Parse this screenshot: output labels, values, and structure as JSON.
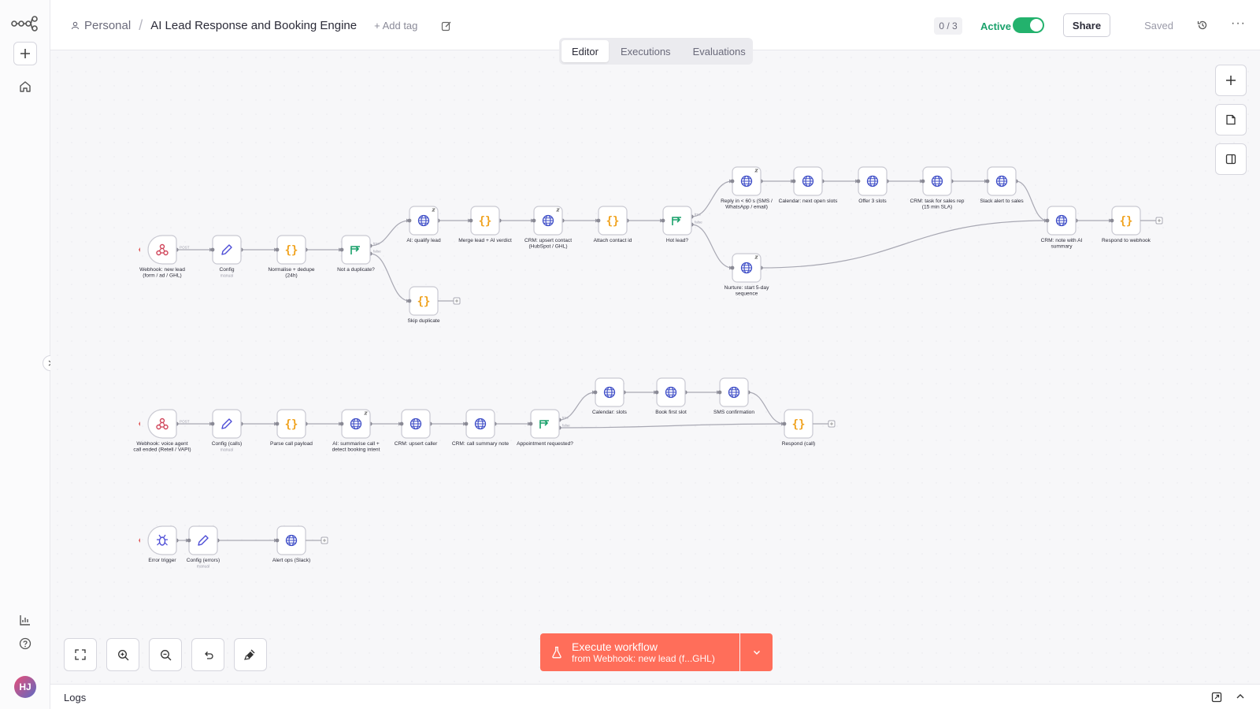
{
  "header": {
    "workspace": "Personal",
    "workflow_title": "AI Lead Response and Booking Engine",
    "add_tag": "+ Add tag",
    "counter": "0 / 3",
    "active_label": "Active",
    "share_label": "Share",
    "saved_label": "Saved"
  },
  "tabs": [
    {
      "label": "Editor",
      "active": true
    },
    {
      "label": "Executions",
      "active": false
    },
    {
      "label": "Evaluations",
      "active": false
    }
  ],
  "user": {
    "initials": "HJ"
  },
  "execute": {
    "label": "Execute workflow",
    "sublabel": "from Webhook: new lead (f...GHL)"
  },
  "logs_label": "Logs",
  "icons": {
    "logo": "n8n-logo-icon",
    "add": "plus-icon",
    "home": "home-icon",
    "insights": "bar-chart-icon",
    "help": "help-circle-icon",
    "history": "history-icon",
    "more": "more-dots-icon"
  },
  "colors": {
    "accent": "#ff6e5a",
    "active_green": "#23b26d",
    "http_node": "#3f4ec7",
    "code_node": "#f0a21d",
    "if_node": "#1aa16b",
    "webhook_node": "#d0455a",
    "set_node": "#4c4cd6"
  },
  "workflow": {
    "nodes": [
      {
        "id": "wh1",
        "type": "webhook",
        "lines": [
          "Webhook: new lead",
          "(form / ad / GHL)"
        ],
        "port_label": "POST",
        "trigger": true
      },
      {
        "id": "cfg1",
        "type": "set",
        "lines": [
          "Config"
        ],
        "sub": "manual"
      },
      {
        "id": "norm",
        "type": "code",
        "lines": [
          "Normalise + dedupe",
          "(24h)"
        ]
      },
      {
        "id": "dup",
        "type": "if",
        "lines": [
          "Not a duplicate?"
        ],
        "branches": [
          "true",
          "false"
        ]
      },
      {
        "id": "aiq",
        "type": "http",
        "lines": [
          "AI: qualify lead"
        ],
        "badge": true
      },
      {
        "id": "skip",
        "type": "code",
        "lines": [
          "Skip duplicate"
        ],
        "end": true
      },
      {
        "id": "merge",
        "type": "code",
        "lines": [
          "Merge lead + AI verdict"
        ]
      },
      {
        "id": "crmup",
        "type": "http",
        "lines": [
          "CRM: upsert contact",
          "(HubSpot / GHL)"
        ],
        "badge": true
      },
      {
        "id": "attach",
        "type": "code",
        "lines": [
          "Attach contact id"
        ]
      },
      {
        "id": "hot",
        "type": "if",
        "lines": [
          "Hot lead?"
        ],
        "branches": [
          "true",
          "false"
        ]
      },
      {
        "id": "reply",
        "type": "http",
        "lines": [
          "Reply in < 60 s (SMS /",
          "WhatsApp / email)"
        ],
        "badge": true
      },
      {
        "id": "nurture",
        "type": "http",
        "lines": [
          "Nurture: start 5-day",
          "sequence"
        ],
        "badge": true
      },
      {
        "id": "cal1",
        "type": "http",
        "lines": [
          "Calendar: next open slots"
        ]
      },
      {
        "id": "offer",
        "type": "http",
        "lines": [
          "Offer 3 slots"
        ]
      },
      {
        "id": "task",
        "type": "http",
        "lines": [
          "CRM: task for sales rep",
          "(15 min SLA)"
        ]
      },
      {
        "id": "slack1",
        "type": "http",
        "lines": [
          "Slack alert to sales"
        ]
      },
      {
        "id": "note",
        "type": "http",
        "lines": [
          "CRM: note with AI",
          "summary"
        ]
      },
      {
        "id": "resp1",
        "type": "code",
        "lines": [
          "Respond to webhook"
        ],
        "end": true
      },
      {
        "id": "wh2",
        "type": "webhook",
        "lines": [
          "Webhook: voice agent",
          "call ended (Retell / VAPI)"
        ],
        "port_label": "POST",
        "trigger": true
      },
      {
        "id": "cfg2",
        "type": "set",
        "lines": [
          "Config (calls)"
        ],
        "sub": "manual"
      },
      {
        "id": "parse",
        "type": "code",
        "lines": [
          "Parse call payload"
        ]
      },
      {
        "id": "aisum",
        "type": "http",
        "lines": [
          "AI: summarise call +",
          "detect booking intent"
        ],
        "badge": true
      },
      {
        "id": "crmc",
        "type": "http",
        "lines": [
          "CRM: upsert caller"
        ]
      },
      {
        "id": "crmn",
        "type": "http",
        "lines": [
          "CRM: call summary note"
        ]
      },
      {
        "id": "appt",
        "type": "if",
        "lines": [
          "Appointment requested?"
        ],
        "branches": [
          "true",
          "false"
        ]
      },
      {
        "id": "cal2",
        "type": "http",
        "lines": [
          "Calendar: slots"
        ]
      },
      {
        "id": "book",
        "type": "http",
        "lines": [
          "Book first slot"
        ]
      },
      {
        "id": "sms",
        "type": "http",
        "lines": [
          "SMS confirmation"
        ]
      },
      {
        "id": "resp2",
        "type": "code",
        "lines": [
          "Respond (call)"
        ],
        "end": true
      },
      {
        "id": "err",
        "type": "error",
        "lines": [
          "Error trigger"
        ],
        "trigger": true
      },
      {
        "id": "cfg3",
        "type": "set",
        "lines": [
          "Config (errors)"
        ],
        "sub": "manual"
      },
      {
        "id": "alert",
        "type": "http",
        "lines": [
          "Alert ops (Slack)"
        ],
        "end": true
      }
    ],
    "connections": [
      [
        "wh1",
        "cfg1"
      ],
      [
        "cfg1",
        "norm"
      ],
      [
        "norm",
        "dup"
      ],
      [
        "dup",
        "aiq",
        0
      ],
      [
        "dup",
        "skip",
        1
      ],
      [
        "aiq",
        "merge"
      ],
      [
        "merge",
        "crmup"
      ],
      [
        "crmup",
        "attach"
      ],
      [
        "attach",
        "hot"
      ],
      [
        "hot",
        "reply",
        0
      ],
      [
        "hot",
        "nurture",
        1
      ],
      [
        "reply",
        "cal1"
      ],
      [
        "cal1",
        "offer"
      ],
      [
        "offer",
        "task"
      ],
      [
        "task",
        "slack1"
      ],
      [
        "slack1",
        "note"
      ],
      [
        "nurture",
        "note"
      ],
      [
        "note",
        "resp1"
      ],
      [
        "wh2",
        "cfg2"
      ],
      [
        "cfg2",
        "parse"
      ],
      [
        "parse",
        "aisum"
      ],
      [
        "aisum",
        "crmc"
      ],
      [
        "crmc",
        "crmn"
      ],
      [
        "crmn",
        "appt"
      ],
      [
        "appt",
        "cal2",
        0
      ],
      [
        "appt",
        "resp2",
        1
      ],
      [
        "cal2",
        "book"
      ],
      [
        "book",
        "sms"
      ],
      [
        "sms",
        "resp2"
      ],
      [
        "err",
        "cfg3"
      ],
      [
        "cfg3",
        "alert"
      ]
    ]
  }
}
